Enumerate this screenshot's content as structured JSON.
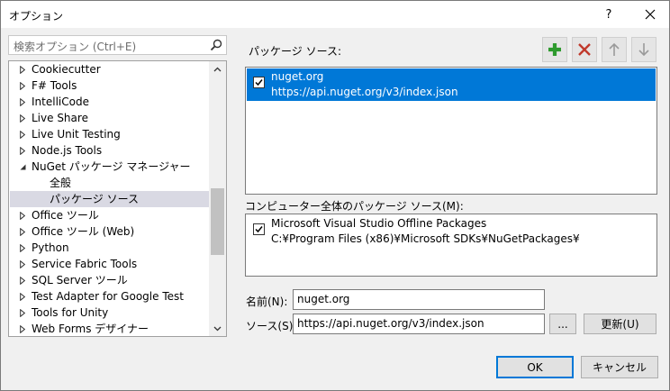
{
  "window": {
    "title": "オプション",
    "help_label": "?"
  },
  "search": {
    "placeholder": "検索オプション (Ctrl+E)"
  },
  "tree": {
    "items": [
      {
        "label": "Cookiecutter",
        "expander": "collapsed"
      },
      {
        "label": "F# Tools",
        "expander": "collapsed"
      },
      {
        "label": "IntelliCode",
        "expander": "collapsed"
      },
      {
        "label": "Live Share",
        "expander": "collapsed"
      },
      {
        "label": "Live Unit Testing",
        "expander": "collapsed"
      },
      {
        "label": "Node.js Tools",
        "expander": "collapsed"
      },
      {
        "label": "NuGet パッケージ マネージャー",
        "expander": "expanded"
      },
      {
        "label": "全般",
        "expander": "none"
      },
      {
        "label": "パッケージ ソース",
        "expander": "none",
        "selected": true
      },
      {
        "label": "Office ツール",
        "expander": "collapsed"
      },
      {
        "label": "Office ツール (Web)",
        "expander": "collapsed"
      },
      {
        "label": "Python",
        "expander": "collapsed"
      },
      {
        "label": "Service Fabric Tools",
        "expander": "collapsed"
      },
      {
        "label": "SQL Server ツール",
        "expander": "collapsed"
      },
      {
        "label": "Test Adapter for Google Test",
        "expander": "collapsed"
      },
      {
        "label": "Tools for Unity",
        "expander": "collapsed"
      },
      {
        "label": "Web Forms デザイナー",
        "expander": "collapsed"
      }
    ]
  },
  "package_sources": {
    "label": "パッケージ ソース:",
    "items": [
      {
        "name": "nuget.org",
        "url": "https://api.nuget.org/v3/index.json",
        "checked": true,
        "selected": true
      }
    ]
  },
  "machine_sources": {
    "label": "コンピューター全体のパッケージ ソース(M):",
    "items": [
      {
        "name": "Microsoft Visual Studio Offline Packages",
        "url": "C:¥Program Files (x86)¥Microsoft SDKs¥NuGetPackages¥",
        "checked": true
      }
    ]
  },
  "form": {
    "name_label": "名前(N):",
    "name_value": "nuget.org",
    "source_label": "ソース(S):",
    "source_value": "https://api.nuget.org/v3/index.json",
    "browse_label": "...",
    "update_label": "更新(U)"
  },
  "footer": {
    "ok_label": "OK",
    "cancel_label": "キャンセル"
  },
  "colors": {
    "selection": "#0078d7",
    "add_green": "#2e9a2e",
    "remove_red": "#c0392b",
    "tree_selection": "#d9d9e3"
  }
}
